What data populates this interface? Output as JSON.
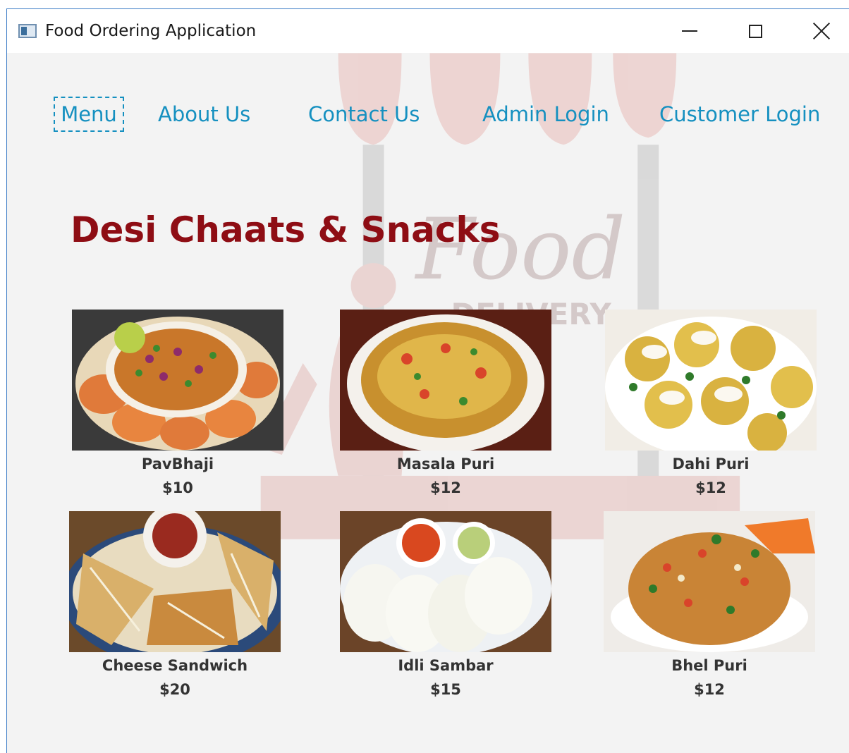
{
  "window": {
    "title": "Food Ordering Application",
    "icons": {
      "app": "app-window-icon",
      "minimize": "minimize-icon",
      "maximize": "maximize-icon",
      "close": "close-icon"
    }
  },
  "nav": {
    "menu": "Menu",
    "about": "About Us",
    "contact": "Contact Us",
    "admin_login": "Admin Login",
    "customer_login": "Customer Login"
  },
  "main": {
    "heading": "Desi Chaats & Snacks",
    "items": [
      {
        "name": "PavBhaji",
        "price": "$10"
      },
      {
        "name": "Masala Puri",
        "price": "$12"
      },
      {
        "name": "Dahi Puri",
        "price": "$12"
      },
      {
        "name": "Cheese Sandwich",
        "price": "$20"
      },
      {
        "name": "Idli Sambar",
        "price": "$15"
      },
      {
        "name": "Bhel Puri",
        "price": "$12"
      }
    ]
  },
  "colors": {
    "nav_link": "#1590c0",
    "heading": "#8e0d14",
    "item_text": "#333333",
    "background": "#f3f3f3"
  }
}
